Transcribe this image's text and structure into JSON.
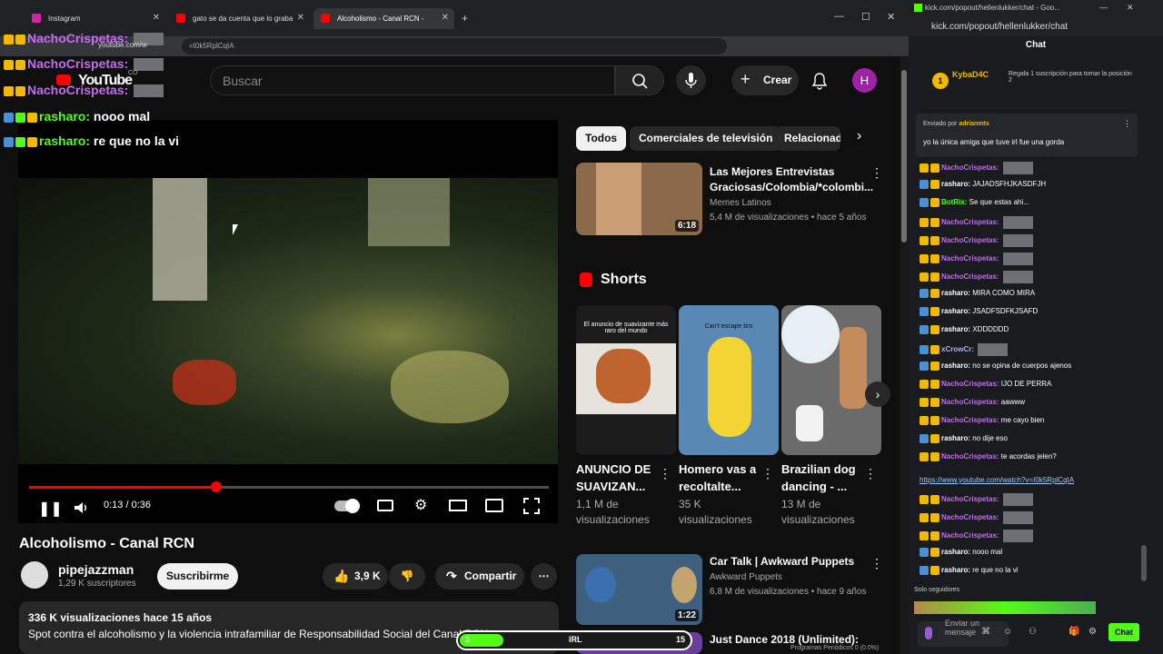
{
  "browser": {
    "tabs": [
      {
        "label": "Instagram"
      },
      {
        "label": "gato se da cuenta que lo graba"
      },
      {
        "label": "Alcoholismo - Canal RCN -"
      }
    ],
    "url": "youtube.com/watch?v=I0k5RplCqIA",
    "url_short": "youtube.com/w",
    "url_tail": "=I0k5RplCqIA"
  },
  "youtube": {
    "logo": "YouTube",
    "logo_cc": "CO",
    "search_placeholder": "Buscar",
    "create": "Crear",
    "avatar": "H",
    "player": {
      "time": "0:13 / 0:36",
      "progress_fraction": 0.361
    },
    "video_title": "Alcoholismo - Canal RCN",
    "channel": "pipejazzman",
    "subscribers": "1,29 K suscriptores",
    "subscribe": "Suscribirme",
    "likes": "3,9 K",
    "share": "Compartir",
    "description": {
      "stats": "336 K visualizaciones  hace 15 años",
      "text": "Spot contra el alcoholismo y la violencia intrafamiliar de Responsabilidad Social del Canal RCN"
    },
    "chips": [
      "Todos",
      "Comerciales de televisión",
      "Relacionad"
    ],
    "rec": [
      {
        "title": "Las Mejores Entrevistas Graciosas/Colombia/*colombi...",
        "channel": "Memes Latinos",
        "meta": "5,4 M de visualizaciones • hace 5 años",
        "duration": "6:18"
      },
      {
        "title": "Car Talk | Awkward Puppets",
        "channel": "Awkward Puppets",
        "meta": "6,8 M de visualizaciones • hace 9 años",
        "duration": "1:22"
      },
      {
        "title": "Just Dance 2018 (Unlimited):"
      }
    ],
    "shorts_title": "Shorts",
    "shorts": [
      {
        "title": "ANUNCIO DE SUAVIZAN...",
        "views": "1,1 M de visualizaciones",
        "overlay": "El anuncio de suavizante más raro del mundo"
      },
      {
        "title": "Homero vas a recoltalte...",
        "views": "35 K visualizaciones",
        "overlay": "Can't escape bro"
      },
      {
        "title": "Brazilian dog dancing - ...",
        "views": "13 M de visualizaciones"
      }
    ]
  },
  "overlay_chat": [
    {
      "user": "NachoCrispetas:",
      "msg": ""
    },
    {
      "user": "NachoCrispetas:",
      "msg": ""
    },
    {
      "user": "NachoCrispetas:",
      "msg": ""
    },
    {
      "user": "rasharo:",
      "msg": "nooo mal"
    },
    {
      "user": "rasharo:",
      "msg": "re que no la vi"
    }
  ],
  "kick": {
    "url": "kick.com/popout/hellenlukker/chat - Goo...",
    "address": "kick.com/popout/hellenlukker/chat",
    "chat_title": "Chat",
    "gifter": "KybaD4C",
    "gifter_count": "1",
    "gift_text": "Regala 1 suscripción para tomar la posición 2",
    "pinned_by": "Enviado por",
    "pinned_user": "adrianmts",
    "pinned_text": "yo la única amiga que tuve irl fue una gorda",
    "messages": [
      {
        "user": "NachoCrispetas:",
        "msg": "",
        "c": "ncol",
        "e": true
      },
      {
        "user": "rasharo:",
        "msg": "JAJADSFHJKASDFJH",
        "c": "rcol"
      },
      {
        "user": "BotRix:",
        "msg": "Se que estas ahi...",
        "c": "bcol"
      },
      {
        "user": "NachoCrispetas:",
        "msg": "",
        "c": "ncol",
        "e": true
      },
      {
        "user": "NachoCrispetas:",
        "msg": "",
        "c": "ncol",
        "e": true
      },
      {
        "user": "NachoCrispetas:",
        "msg": "",
        "c": "ncol",
        "e": true
      },
      {
        "user": "NachoCrispetas:",
        "msg": "",
        "c": "ncol",
        "e": true
      },
      {
        "user": "rasharo:",
        "msg": "MIRA COMO MIRA",
        "c": "rcol"
      },
      {
        "user": "rasharo:",
        "msg": "JSADFSDFKJSAFD",
        "c": "rcol"
      },
      {
        "user": "rasharo:",
        "msg": "XDDDDDD",
        "c": "rcol"
      },
      {
        "user": "xCrowCr:",
        "msg": "",
        "c": "xcol",
        "e": true
      },
      {
        "user": "rasharo:",
        "msg": "no se opina de cuerpos ajenos",
        "c": "rcol"
      },
      {
        "user": "NachoCrispetas:",
        "msg": "IJO DE PERRA",
        "c": "ncol"
      },
      {
        "user": "NachoCrispetas:",
        "msg": "aawww",
        "c": "ncol"
      },
      {
        "user": "NachoCrispetas:",
        "msg": "me cayo bien",
        "c": "ncol"
      },
      {
        "user": "rasharo:",
        "msg": "no dije eso",
        "c": "rcol"
      },
      {
        "user": "NachoCrispetas:",
        "msg": "te acordas jelen?",
        "c": "ncol"
      }
    ],
    "link": "https://www.youtube.com/watch?v=I0k5RplCqIA",
    "messages2": [
      {
        "user": "NachoCrispetas:",
        "msg": "",
        "c": "ncol",
        "e": true
      },
      {
        "user": "NachoCrispetas:",
        "msg": "",
        "c": "ncol",
        "e": true
      },
      {
        "user": "NachoCrispetas:",
        "msg": "",
        "c": "ncol",
        "e": true
      },
      {
        "user": "rasharo:",
        "msg": "nooo mal",
        "c": "rcol"
      },
      {
        "user": "rasharo:",
        "msg": "re que no la vi",
        "c": "rcol"
      }
    ],
    "followers_only": "Solo seguidores",
    "send_placeholder": "Enviar un mensaje",
    "chat_button": "Chat"
  },
  "bottom": {
    "irl": "IRL",
    "count1": "3",
    "count2": "15",
    "obs": "Programas Periódicos 0 (0.0%)"
  },
  "colors": {
    "yt_red": "#ff0000",
    "kick_green": "#53fc18",
    "nacho": "#c56cf0"
  }
}
